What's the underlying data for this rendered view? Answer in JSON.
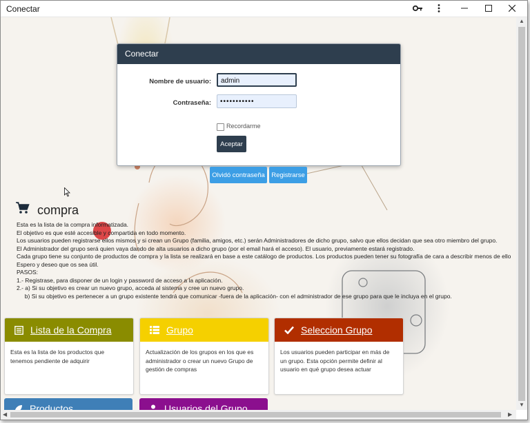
{
  "window": {
    "title": "Conectar",
    "icons": [
      "key-icon",
      "more-vert-icon",
      "minimize-icon",
      "maximize-icon",
      "close-icon"
    ]
  },
  "login": {
    "header": "Conectar",
    "username_label": "Nombre de usuario:",
    "username_value": "admin",
    "password_label": "Contraseña:",
    "password_value": "•••••••••••",
    "remember_label": "Recordarme",
    "submit_label": "Aceptar"
  },
  "links": {
    "forgot_label": "Olvidó contraseña",
    "register_label": "Registrarse"
  },
  "intro": {
    "title": "compra",
    "text": "Esta es la lista de la compra informatizada.\nEl objetivo es que esté accesible y compartida en todo momento.\nLos usuarios pueden registrarse ellos mismos y si crean un Grupo (familia, amigos, etc.) serán Administradores de dicho grupo, salvo que ellos decidan que sea otro miembro del grupo.\nEl Administrador del grupo será quien vaya dando de alta usuarios a dicho grupo (por el email hará el acceso). El usuario, previamente estará registrado.\nCada grupo tiene su conjunto de productos de compra y la lista se realizará en base a este catálogo de productos. Los productos pueden tener su fotografía de cara a describir menos de ello\nEspero y deseo que os sea útil.\nPASOS:\n1.- Registrase, para disponer de un login y password de acceso a la aplicación.\n2.- a) Si su objetivo es crear un nuevo grupo, acceda al sistema y cree un nuevo grupo.\n     b) Si su objetivo es pertenecer a un grupo existente tendrá que comunicar -fuera de la aplicación- con el administrador de ese grupo para que le incluya en el grupo."
  },
  "cards": [
    {
      "title": "Lista de la Compra",
      "icon": "list-icon",
      "color": "#8a8c00",
      "text": "Esta es la lista de los productos que tenemos pendiente de adquirir"
    },
    {
      "title": "Grupo",
      "icon": "th-list-icon",
      "color": "#f5d000",
      "text": "Actualización de los grupos en los que es administrador o crear un nuevo Grupo de gestión de compras"
    },
    {
      "title": "Seleccion Grupo",
      "icon": "check-icon",
      "color": "#b12e00",
      "text": "Los usuarios pueden participar en más de un grupo. Esta opción permite definir al usuario en qué grupo desea actuar"
    }
  ],
  "cards_row2": [
    {
      "title": "Productos",
      "icon": "leaf-icon",
      "color": "#3f7fb7"
    },
    {
      "title": "Usuarios del Grupo",
      "icon": "user-icon",
      "color": "#8b0f8e"
    }
  ],
  "colors": {
    "navy": "#2e3e4e",
    "link_blue": "#3c9ee5",
    "input_bg": "#e8f0fd"
  }
}
